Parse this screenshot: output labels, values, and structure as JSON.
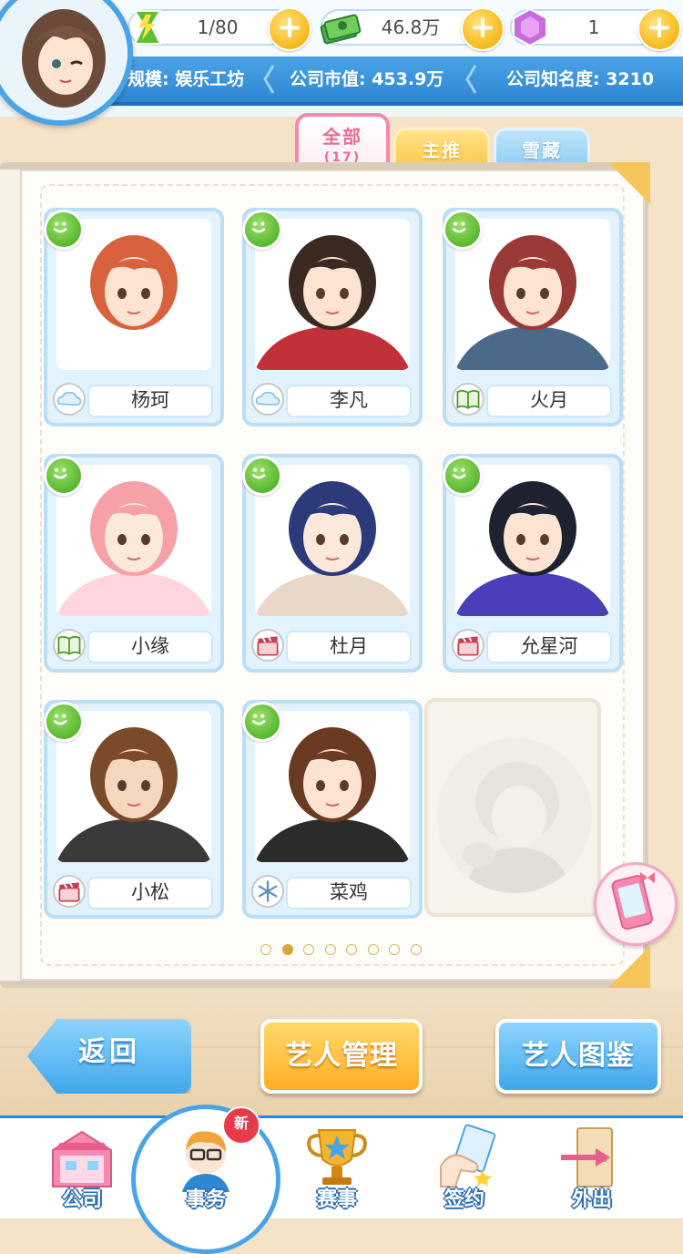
{
  "resources": {
    "energy": "1/80",
    "money": "46.8万",
    "gems": "1"
  },
  "stats": {
    "scale": "规模: 娱乐工坊",
    "market_value": "公司市值: 453.9万",
    "fame": "公司知名度: 3210"
  },
  "tabs": {
    "all_label": "全部",
    "all_count": "(17)",
    "featured_label": "主推",
    "hidden_label": "雪藏"
  },
  "artists": [
    {
      "name": "杨珂",
      "genre_icon": "cloud-icon"
    },
    {
      "name": "李凡",
      "genre_icon": "cloud-icon"
    },
    {
      "name": "火月",
      "genre_icon": "book-icon"
    },
    {
      "name": "小缘",
      "genre_icon": "book-icon"
    },
    {
      "name": "杜月",
      "genre_icon": "clapperboard-icon"
    },
    {
      "name": "允星河",
      "genre_icon": "clapperboard-icon"
    },
    {
      "name": "小松",
      "genre_icon": "clapperboard-icon"
    },
    {
      "name": "菜鸡",
      "genre_icon": "snowflake-icon"
    }
  ],
  "pagination": {
    "total": 8,
    "current": 2
  },
  "buttons": {
    "back": "返回",
    "manage": "艺人管理",
    "guide": "艺人图鉴"
  },
  "nav": {
    "company": "公司",
    "affairs": "事务",
    "contest": "赛事",
    "sign": "签约",
    "outing": "外出",
    "new_badge": "新"
  }
}
